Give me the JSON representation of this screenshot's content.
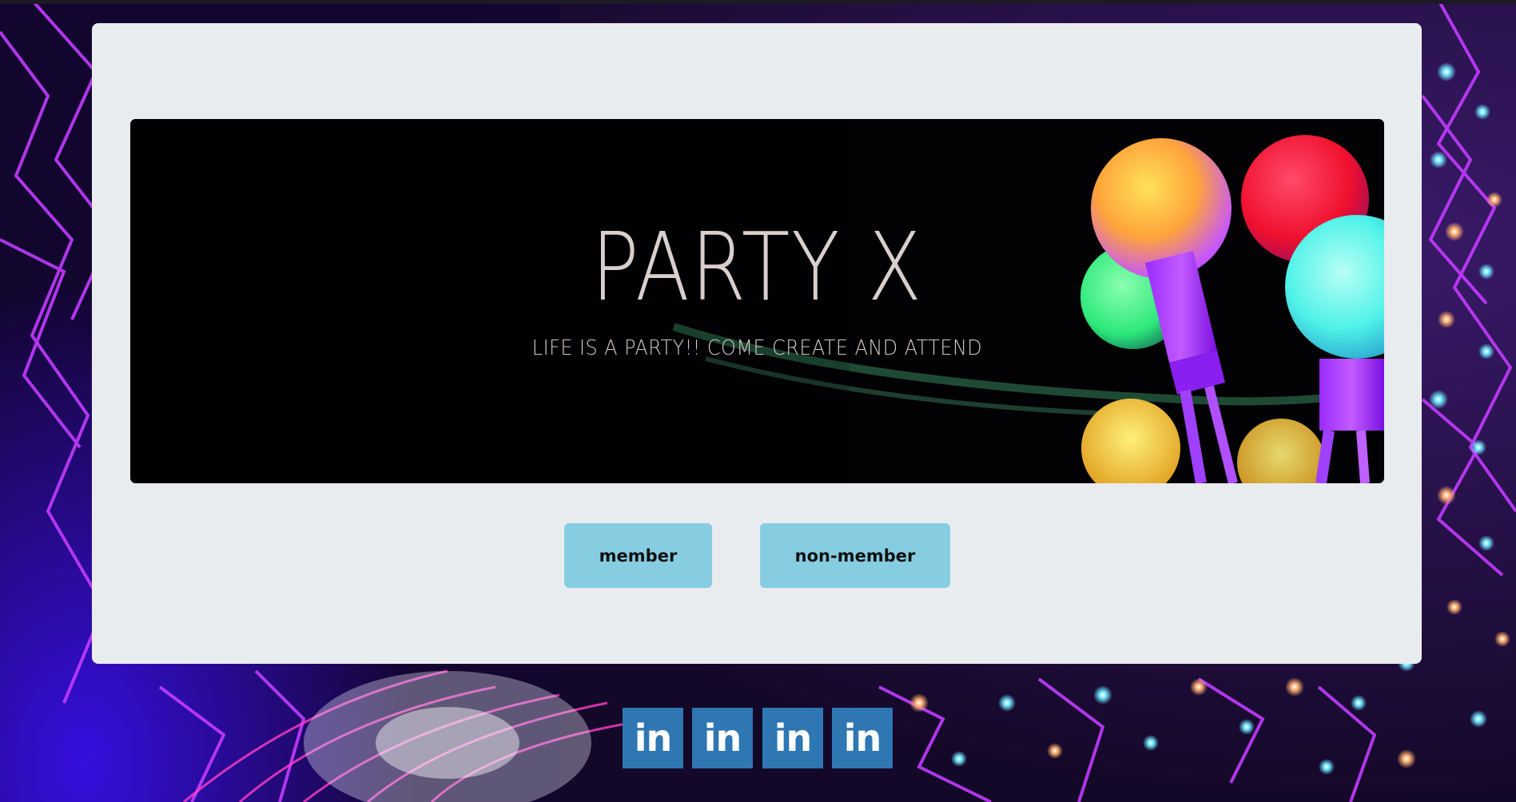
{
  "hero": {
    "title": "PARTY X",
    "subtitle": "LIFE IS A PARTY!! COME CREATE AND ATTEND"
  },
  "buttons": {
    "member_label": "member",
    "nonmember_label": "non-member"
  },
  "social": [
    {
      "icon": "linkedin-icon",
      "label": "in"
    },
    {
      "icon": "linkedin-icon",
      "label": "in"
    },
    {
      "icon": "linkedin-icon",
      "label": "in"
    },
    {
      "icon": "linkedin-icon",
      "label": "in"
    }
  ],
  "colors": {
    "card_bg": "#e9ecef",
    "button_bg": "#86cde2",
    "social_bg": "#2e77b3",
    "title_color": "#d9cfcd"
  }
}
